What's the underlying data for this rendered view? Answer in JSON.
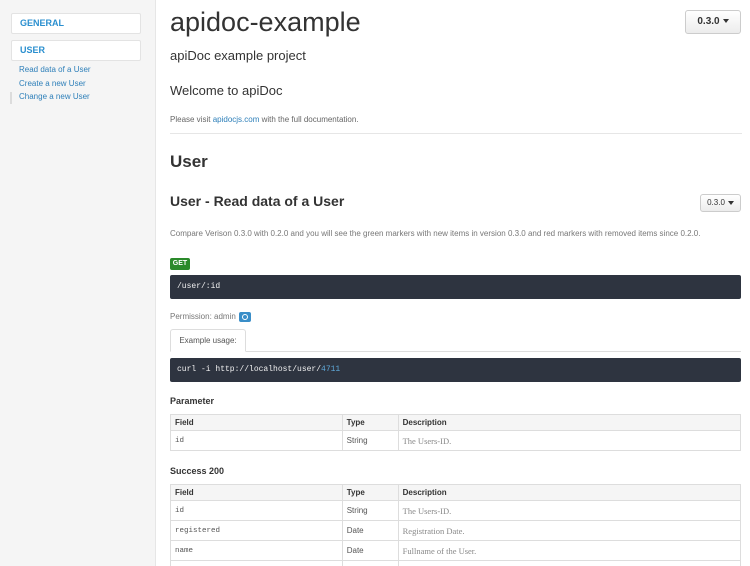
{
  "sidebar": {
    "general_label": "GENERAL",
    "user_label": "USER",
    "links": [
      "Read data of a User",
      "Create a new User",
      "Change a new User"
    ]
  },
  "header": {
    "title": "apidoc-example",
    "version": "0.3.0",
    "subtitle": "apiDoc example project"
  },
  "intro": {
    "welcome": "Welcome to apiDoc",
    "visit_prefix": "Please visit ",
    "visit_link": "apidocjs.com",
    "visit_suffix": " with the full documentation."
  },
  "group": {
    "title": "User"
  },
  "endpoint": {
    "title": "User - Read data of a User",
    "version": "0.3.0",
    "description": "Compare Verison 0.3.0 with 0.2.0 and you will see the green markers with new items in version 0.3.0 and red markers with removed items since 0.2.0.",
    "method": "GET",
    "path": "/user/:id",
    "permission": "Permission: admin",
    "example_tab": "Example usage:",
    "example_code_prefix": "curl -i http://localhost/user/",
    "example_code_num": "4711"
  },
  "parameter": {
    "title": "Parameter",
    "headers": [
      "Field",
      "Type",
      "Description"
    ],
    "rows": [
      [
        "id",
        "String",
        "The Users-ID."
      ]
    ]
  },
  "success": {
    "title": "Success 200",
    "headers": [
      "Field",
      "Type",
      "Description"
    ],
    "rows": [
      [
        "id",
        "String",
        "The Users-ID."
      ],
      [
        "registered",
        "Date",
        "Registration Date."
      ],
      [
        "name",
        "Date",
        "Fullname of the User."
      ]
    ]
  }
}
